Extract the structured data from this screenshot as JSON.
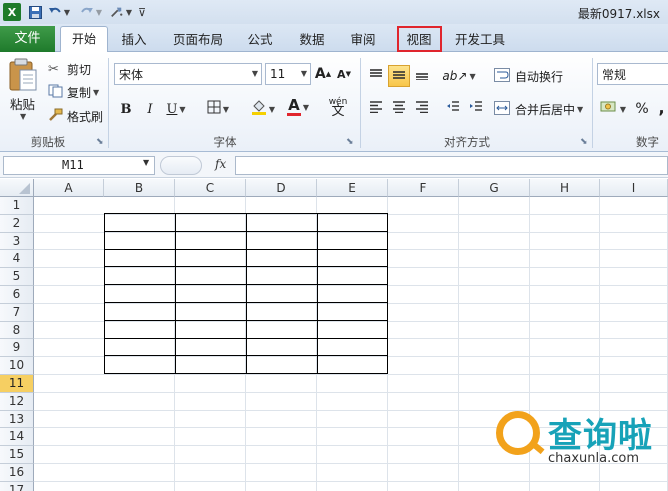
{
  "app": {
    "window_title": "最新0917.xlsx",
    "brand_color": "#217346",
    "highlight_color": "#e0252d"
  },
  "quick_access": {
    "icons": [
      "excel-icon",
      "save-icon",
      "undo-icon",
      "redo-icon",
      "format-painter-icon",
      "customize-icon"
    ]
  },
  "tabs": {
    "file": "文件",
    "home": "开始",
    "insert": "插入",
    "page_layout": "页面布局",
    "formulas": "公式",
    "data": "数据",
    "review": "审阅",
    "view": "视图",
    "developer": "开发工具"
  },
  "ribbon": {
    "clipboard": {
      "label": "剪贴板",
      "paste": "粘贴",
      "cut": "剪切",
      "copy": "复制",
      "format_painter": "格式刷"
    },
    "font": {
      "label": "字体",
      "font_name": "宋体",
      "font_size": "11",
      "bold": "B",
      "italic": "I",
      "underline": "U",
      "grow": "A",
      "shrink": "A",
      "font_color": "A",
      "phonetic": "wén"
    },
    "alignment": {
      "label": "对齐方式",
      "wrap_text": "自动换行",
      "merge_center": "合并后居中"
    },
    "number": {
      "label": "数字",
      "format": "常规",
      "percent": "%",
      "comma": ","
    }
  },
  "formula_bar": {
    "name_box": "M11",
    "fx": "fx",
    "formula": ""
  },
  "sheet": {
    "columns": [
      "A",
      "B",
      "C",
      "D",
      "E",
      "F",
      "G",
      "H",
      "I"
    ],
    "rows": [
      "1",
      "2",
      "3",
      "4",
      "5",
      "6",
      "7",
      "8",
      "9",
      "10",
      "11",
      "12",
      "13",
      "14",
      "15",
      "16",
      "17"
    ],
    "selected_row": "11",
    "selected_cell": "M11"
  },
  "watermark": {
    "title": "查询啦",
    "url": "chaxunla.com"
  }
}
